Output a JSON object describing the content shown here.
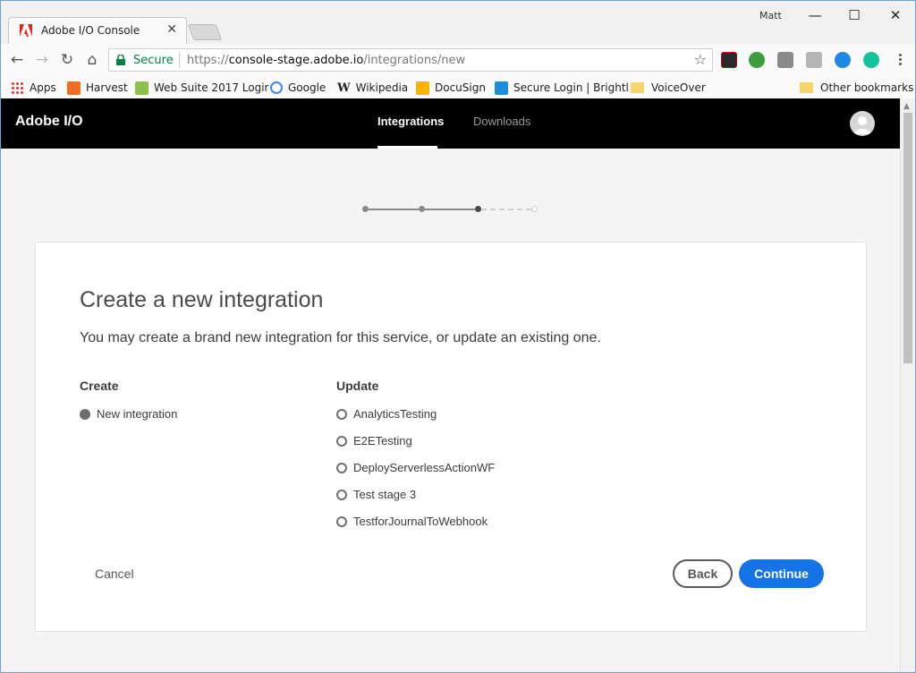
{
  "browser": {
    "tab_title": "Adobe I/O Console",
    "profile_name": "Matt",
    "secure_label": "Secure",
    "url_scheme": "https://",
    "url_host": "console-stage.adobe.io",
    "url_path": "/integrations/new",
    "bookmarks": [
      {
        "label": "Apps",
        "icon": "apps-grid-icon"
      },
      {
        "label": "Harvest",
        "icon": "harvest-icon"
      },
      {
        "label": "Web Suite 2017 Logir",
        "icon": "web-suite-icon"
      },
      {
        "label": "Google",
        "icon": "google-icon"
      },
      {
        "label": "Wikipedia",
        "icon": "wikipedia-icon"
      },
      {
        "label": "DocuSign",
        "icon": "docusign-icon"
      },
      {
        "label": "Secure Login | Brightl",
        "icon": "brightcove-icon"
      },
      {
        "label": "VoiceOver",
        "icon": "folder-icon"
      }
    ],
    "other_bookmarks": "Other bookmarks"
  },
  "app": {
    "brand": "Adobe I/O",
    "nav": [
      {
        "label": "Integrations",
        "active": true
      },
      {
        "label": "Downloads",
        "active": false
      }
    ]
  },
  "wizard": {
    "steps_total": 4,
    "current_step": 3
  },
  "card": {
    "title": "Create a new integration",
    "subtitle": "You may create a brand new integration for this service, or update an existing one.",
    "create_heading": "Create",
    "create_option": "New integration",
    "update_heading": "Update",
    "update_options": [
      "AnalyticsTesting",
      "E2ETesting",
      "DeployServerlessActionWF",
      "Test stage 3",
      "TestforJournalToWebhook"
    ],
    "cancel_label": "Cancel",
    "back_label": "Back",
    "continue_label": "Continue"
  },
  "colors": {
    "accent": "#1473e6",
    "appbar": "#000000",
    "secure_green": "#0b8043"
  }
}
